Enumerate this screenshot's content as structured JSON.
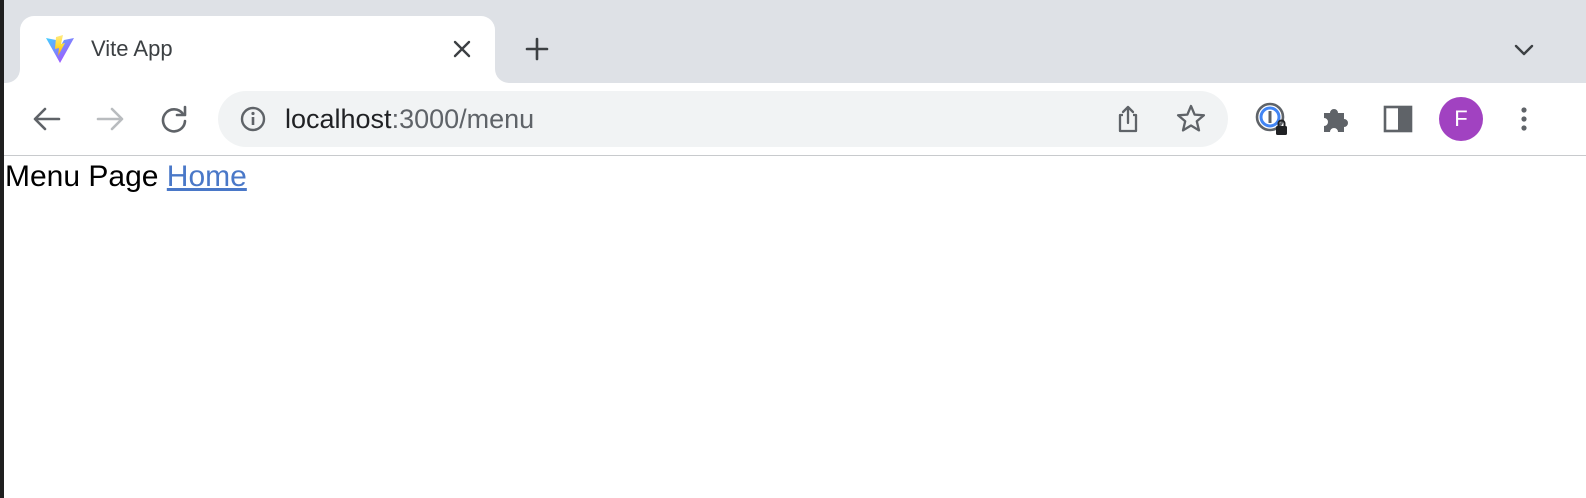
{
  "browser": {
    "tab": {
      "title": "Vite App",
      "favicon": "vite-logo-icon",
      "close_icon": "close-icon"
    },
    "new_tab_icon": "plus-icon",
    "tab_search_icon": "chevron-down-icon",
    "toolbar": {
      "back_icon": "arrow-left-icon",
      "forward_icon": "arrow-right-icon",
      "reload_icon": "reload-icon",
      "omnibox": {
        "site_info_icon": "info-icon",
        "url_host": "localhost",
        "url_rest": ":3000/menu",
        "share_icon": "share-icon",
        "bookmark_icon": "star-icon"
      },
      "extensions": {
        "password_manager_icon": "password-lock-icon",
        "puzzle_icon": "puzzle-icon",
        "side_panel_icon": "side-panel-icon"
      },
      "profile": {
        "initial": "F",
        "color": "#a142c1"
      },
      "menu_icon": "kebab-menu-icon"
    }
  },
  "page": {
    "heading_text": "Menu Page",
    "home_link": "Home",
    "link_color": "#4a78c8"
  }
}
